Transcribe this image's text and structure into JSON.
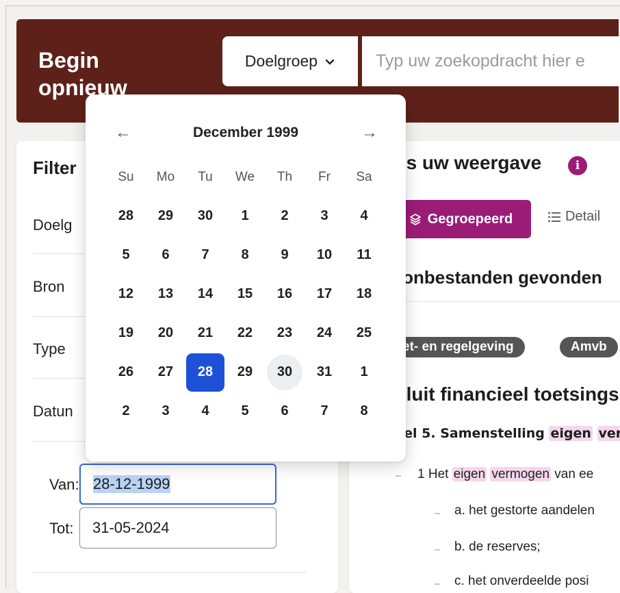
{
  "header": {
    "brand": "Begin opnieuw",
    "audience_label": "Doelgroep",
    "search_placeholder": "Typ uw zoekopdracht hier e"
  },
  "filters": {
    "title": "Filter",
    "items": [
      "Doelg",
      "Bron",
      "Type",
      "Datun"
    ],
    "from_label": "Van:",
    "from_value": "28-12-1999",
    "to_label": "Tot:",
    "to_value": "31-05-2024"
  },
  "calendar": {
    "prev_icon": "arrow-left-icon",
    "next_icon": "arrow-right-icon",
    "prev_glyph": "←",
    "next_glyph": "→",
    "month_label": "December 1999",
    "weekdays": [
      "Su",
      "Mo",
      "Tu",
      "We",
      "Th",
      "Fr",
      "Sa"
    ],
    "weeks": [
      [
        "28",
        "29",
        "30",
        "1",
        "2",
        "3",
        "4"
      ],
      [
        "5",
        "6",
        "7",
        "8",
        "9",
        "10",
        "11"
      ],
      [
        "12",
        "13",
        "14",
        "15",
        "16",
        "17",
        "18"
      ],
      [
        "19",
        "20",
        "21",
        "22",
        "23",
        "24",
        "25"
      ],
      [
        "26",
        "27",
        "28",
        "29",
        "30",
        "31",
        "1"
      ],
      [
        "2",
        "3",
        "4",
        "5",
        "6",
        "7",
        "8"
      ]
    ],
    "selected_day": "28",
    "highlighted_day": "30",
    "selected_color": "#1d52d8"
  },
  "results": {
    "view_title": "es uw weergave",
    "info_icon": "info-icon",
    "info_glyph": "i",
    "grouped_label": "Gegroepeerd",
    "detail_label": "Detail",
    "count_text": "ronbestanden gevonden",
    "tags": [
      "et- en regelgeving",
      "Amvb"
    ],
    "doc_title": "sluit financieel toetsings",
    "article_prefix": "kel 5. Samenstelling ",
    "article_hl1": "eigen",
    "article_hl2": "verm",
    "para1_prefix": "1 Het ",
    "para1_hl1": "eigen",
    "para1_hl2": "vermogen",
    "para1_suffix": " van ee",
    "list": [
      "a. het gestorte aandelen",
      "b. de reserves;",
      "c. het onverdeelde posi"
    ],
    "accent_color": "#9b1c77"
  }
}
